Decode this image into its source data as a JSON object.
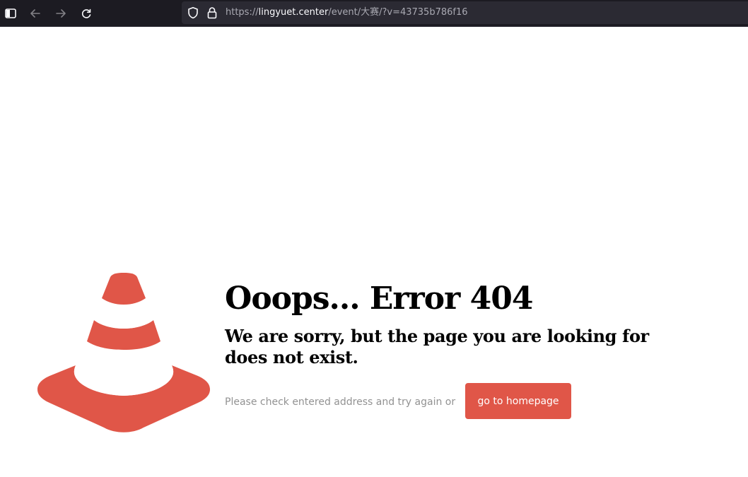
{
  "browser": {
    "url_scheme": "https://",
    "url_host": "lingyuet.center",
    "url_path": "/event/大赛/?v=43735b786f16",
    "icons": {
      "sidebar": "sidebar-icon",
      "back": "arrow-left-icon",
      "forward": "arrow-right-icon",
      "reload": "reload-icon",
      "shield": "shield-icon",
      "lock": "lock-icon"
    }
  },
  "error_page": {
    "title": "Ooops... Error 404",
    "subtitle": "We are sorry, but the page you are looking for does not exist.",
    "help_text": "Please check entered address and try again or",
    "home_button_label": "go to homepage",
    "illustration": "traffic-cone-icon"
  },
  "colors": {
    "accent": "#e05648",
    "chrome_background": "#1c1b22",
    "urlbar_background": "#2b2a33",
    "help_text": "#929292"
  }
}
